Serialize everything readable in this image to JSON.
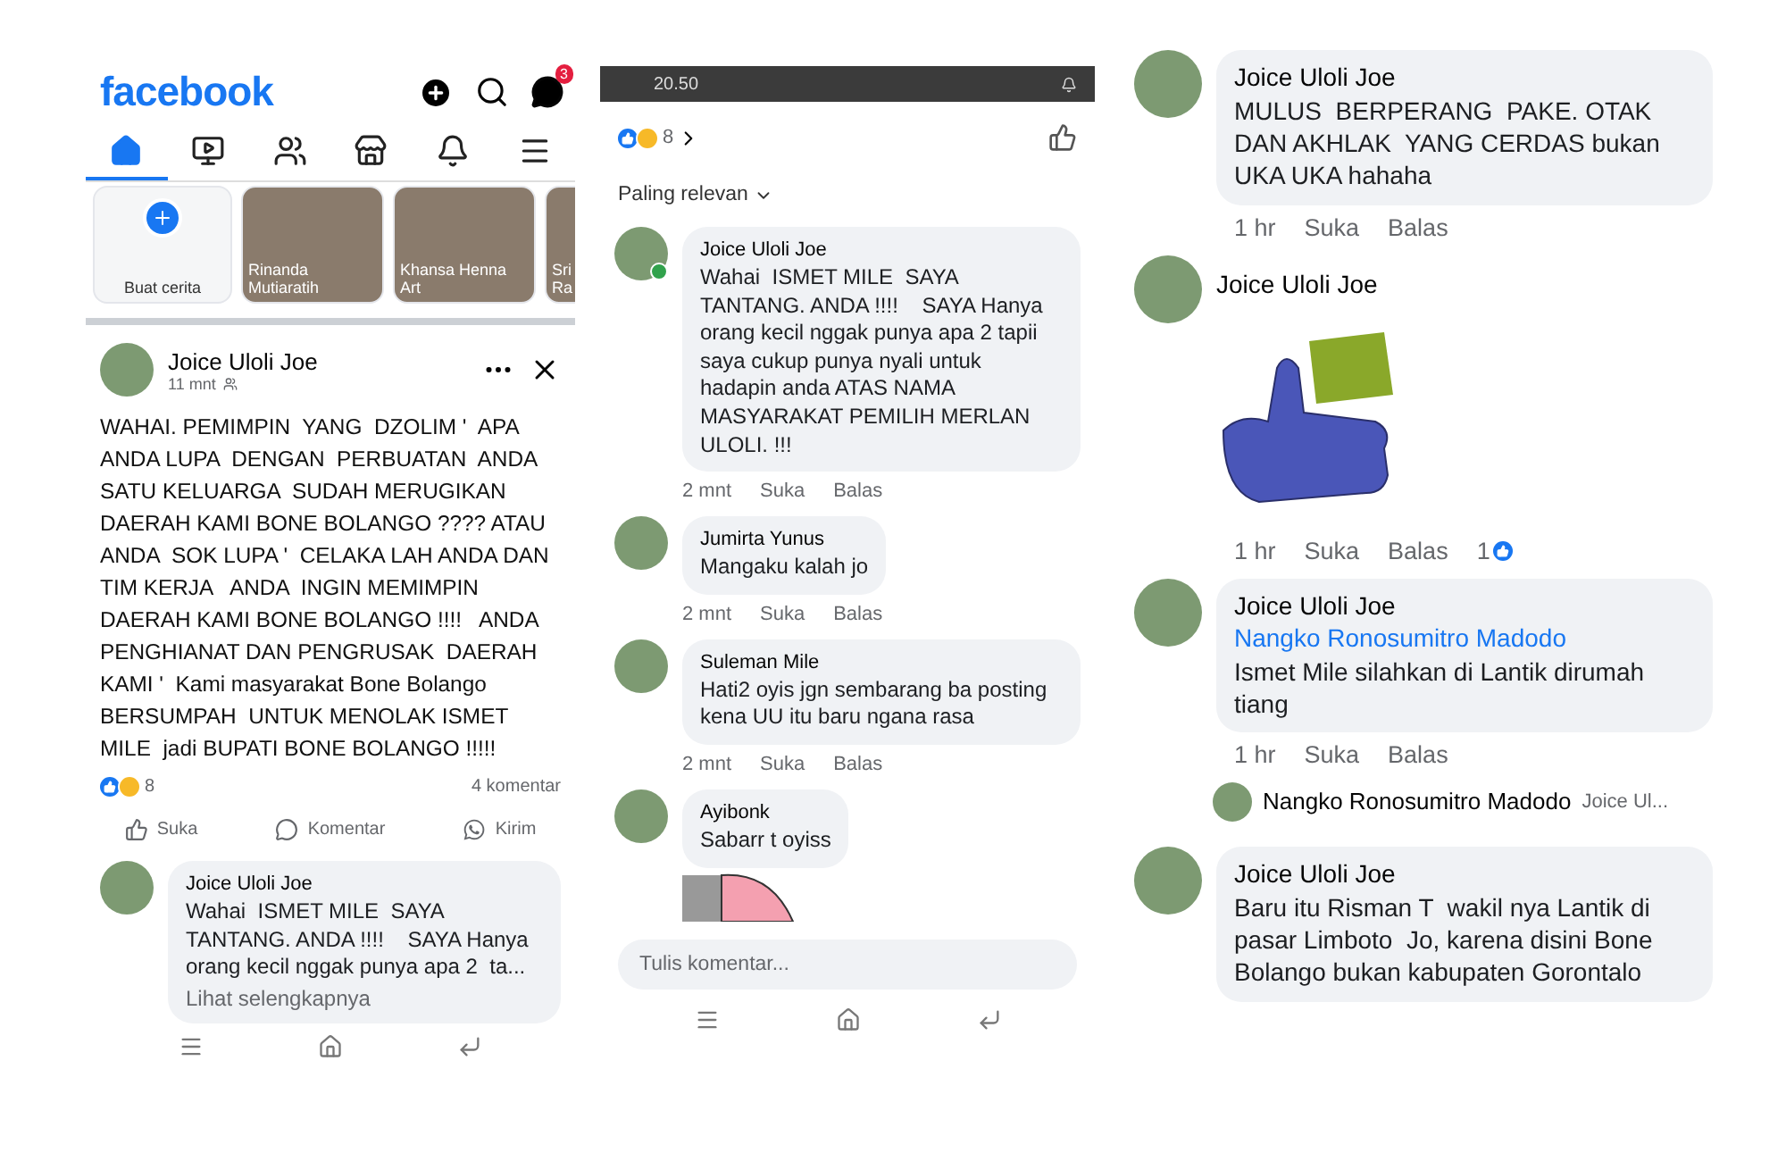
{
  "left_panel": {
    "logo": "facebook",
    "messenger_badge": "3",
    "tabs": [
      {
        "kind": "home",
        "selected": true
      },
      {
        "kind": "video",
        "selected": false
      },
      {
        "kind": "friends",
        "selected": false
      },
      {
        "kind": "marketplace",
        "selected": false
      },
      {
        "kind": "notifications",
        "selected": false
      },
      {
        "kind": "menu",
        "selected": false
      }
    ],
    "stories": [
      {
        "kind": "create",
        "label": "Buat cerita"
      },
      {
        "kind": "story",
        "label": "Rinanda Mutiaratih"
      },
      {
        "kind": "story",
        "label": "Khansa Henna Art"
      },
      {
        "kind": "story",
        "label": "Sri Ra"
      }
    ],
    "post": {
      "author": "Joice Uloli Joe",
      "time": "11 mnt",
      "text": "WAHAI. PEMIMPIN  YANG  DZOLIM '  APA ANDA LUPA  DENGAN  PERBUATAN  ANDA SATU KELUARGA  SUDAH MERUGIKAN DAERAH KAMI BONE BOLANGO ???? ATAU ANDA  SOK LUPA '  CELAKA LAH ANDA DAN  TIM KERJA   ANDA  INGIN MEMIMPIN DAERAH KAMI BONE BOLANGO !!!!   ANDA PENGHIANAT DAN PENGRUSAK  DAERAH KAMI '  Kami masyarakat Bone Bolango BERSUMPAH  UNTUK MENOLAK ISMET MILE  jadi BUPATI BONE BOLANGO !!!!!",
      "reaction_count": "8",
      "comment_count": "4 komentar",
      "actions": [
        {
          "kind": "like",
          "label": "Suka"
        },
        {
          "kind": "comment",
          "label": "Komentar"
        },
        {
          "kind": "send",
          "label": "Kirim"
        }
      ]
    },
    "comment_preview": {
      "author": "Joice Uloli Joe",
      "text": "Wahai  ISMET MILE  SAYA TANTANG. ANDA !!!!    SAYA Hanya orang kecil nggak punya apa 2  ta...",
      "see_more": "Lihat selengkapnya"
    }
  },
  "middle_panel": {
    "status_time": "20.50",
    "reaction_count": "8",
    "sort": "Paling relevan",
    "comments": [
      {
        "author": "Joice Uloli Joe",
        "online": true,
        "text": "Wahai  ISMET MILE  SAYA TANTANG. ANDA !!!!    SAYA Hanya orang kecil nggak punya apa 2 tapii saya cukup punya nyali untuk hadapin anda ATAS NAMA MASYARAKAT PEMILIH MERLAN ULOLI. !!!",
        "time": "2 mnt",
        "like": "Suka",
        "reply": "Balas"
      },
      {
        "author": "Jumirta Yunus",
        "online": false,
        "text": "Mangaku kalah jo",
        "time": "2 mnt",
        "like": "Suka",
        "reply": "Balas"
      },
      {
        "author": "Suleman Mile",
        "online": false,
        "text": "Hati2 oyis jgn sembarang ba posting kena UU itu baru ngana rasa",
        "time": "2 mnt",
        "like": "Suka",
        "reply": "Balas"
      },
      {
        "author": "Ayibonk",
        "online": false,
        "text": "Sabarr t oyiss"
      }
    ],
    "input_placeholder": "Tulis komentar..."
  },
  "right_panel": {
    "comments": [
      {
        "kind": "text",
        "author": "Joice Uloli Joe",
        "text": "MULUS  BERPERANG  PAKE. OTAK DAN AKHLAK  YANG CERDAS bukan  UKA UKA hahaha",
        "time": "1 hr",
        "like": "Suka",
        "reply": "Balas"
      },
      {
        "kind": "sticker",
        "author": "Joice Uloli Joe",
        "time": "1 hr",
        "like": "Suka",
        "reply": "Balas",
        "likes": "1"
      },
      {
        "kind": "text",
        "author": "Joice Uloli Joe",
        "mention": "Nangko Ronosumitro Madodo",
        "text": "Ismet Mile silahkan di Lantik dirumah tiang",
        "time": "1 hr",
        "like": "Suka",
        "reply": "Balas"
      },
      {
        "kind": "reply_preview",
        "author": "Nangko Ronosumitro Madodo",
        "text": "Joice Ul..."
      },
      {
        "kind": "text",
        "author": "Joice Uloli Joe",
        "text": "Baru itu Risman T  wakil nya Lantik di pasar Limboto  Jo, karena disini Bone Bolango bukan kabupaten Gorontalo"
      }
    ]
  }
}
